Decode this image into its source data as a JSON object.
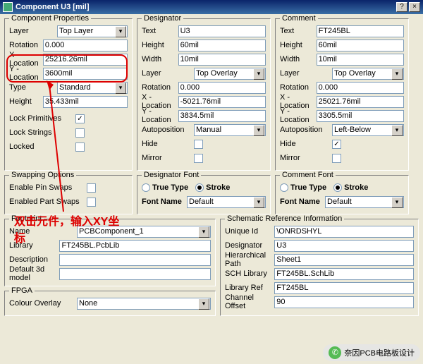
{
  "window": {
    "title": "Component U3 [mil]",
    "help": "?",
    "close": "×"
  },
  "groups": {
    "compProps": "Component Properties",
    "designator": "Designator",
    "comment": "Comment",
    "swapping": "Swapping Options",
    "desFont": "Designator Font",
    "comFont": "Comment Font",
    "footprint": "Footprint",
    "schRef": "Schematic Reference Information",
    "fpga": "FPGA"
  },
  "labels": {
    "layer": "Layer",
    "rotation": "Rotation",
    "xloc": "X - Location",
    "yloc": "Y - Location",
    "type": "Type",
    "height": "Height",
    "lockPrims": "Lock Primitives",
    "lockStrings": "Lock Strings",
    "locked": "Locked",
    "text": "Text",
    "width": "Width",
    "autopos": "Autoposition",
    "hide": "Hide",
    "mirror": "Mirror",
    "enablePin": "Enable Pin Swaps",
    "enablePart": "Enabled Part Swaps",
    "trueType": "True Type",
    "stroke": "Stroke",
    "fontName": "Font Name",
    "name": "Name",
    "library": "Library",
    "description": "Description",
    "default3d": "Default 3d model",
    "uniqueId": "Unique Id",
    "hierPath": "Hierarchical Path",
    "schLib": "SCH Library",
    "libRef": "Library Ref",
    "chanOff": "Channel Offset",
    "colorOverlay": "Colour Overlay"
  },
  "compProps": {
    "layer": "Top Layer",
    "rotation": "0.000",
    "xloc": "25216.26mil",
    "yloc": "3600mil",
    "type": "Standard",
    "height": "35.433mil",
    "lockPrims": true,
    "lockStrings": false,
    "locked": false
  },
  "designator": {
    "text": "U3",
    "height": "60mil",
    "width": "10mil",
    "layer": "Top Overlay",
    "rotation": "0.000",
    "xloc": "-5021.76mil",
    "yloc": "3834.5mil",
    "autopos": "Manual",
    "hide": false,
    "mirror": false
  },
  "comment": {
    "text": "FT245BL",
    "height": "60mil",
    "width": "10mil",
    "layer": "Top Overlay",
    "rotation": "0.000",
    "xloc": "25021.76mil",
    "yloc": "3305.5mil",
    "autopos": "Left-Below",
    "hide": true,
    "mirror": false
  },
  "swapping": {
    "pin": false,
    "part": false
  },
  "desFont": {
    "mode": "stroke",
    "name": "Default"
  },
  "comFont": {
    "mode": "stroke",
    "name": "Default"
  },
  "footprint": {
    "name": "PCBComponent_1",
    "library": "FT245BL.PcbLib",
    "description": "",
    "default3d": ""
  },
  "schRef": {
    "uniqueId": "\\ONRDSHYL",
    "designator": "U3",
    "hierPath": "Sheet1",
    "schLib": "FT245BL.SchLib",
    "libRef": "FT245BL",
    "chanOff": "90"
  },
  "fpga": {
    "colorOverlay": "None"
  },
  "annotation": "双击元件，输入XY坐标",
  "watermark": "奈因PCB电路板设计"
}
